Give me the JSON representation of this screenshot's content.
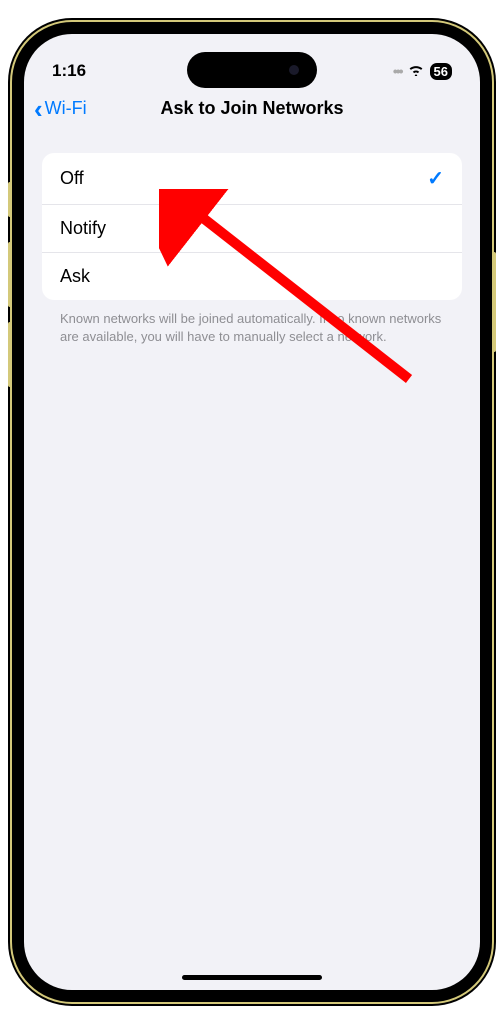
{
  "status": {
    "time": "1:16",
    "battery": "56"
  },
  "nav": {
    "back_label": "Wi-Fi",
    "title": "Ask to Join Networks"
  },
  "options": {
    "items": [
      {
        "label": "Off",
        "selected": true
      },
      {
        "label": "Notify",
        "selected": false
      },
      {
        "label": "Ask",
        "selected": false
      }
    ],
    "footer": "Known networks will be joined automatically. If no known networks are available, you will have to manually select a network."
  }
}
